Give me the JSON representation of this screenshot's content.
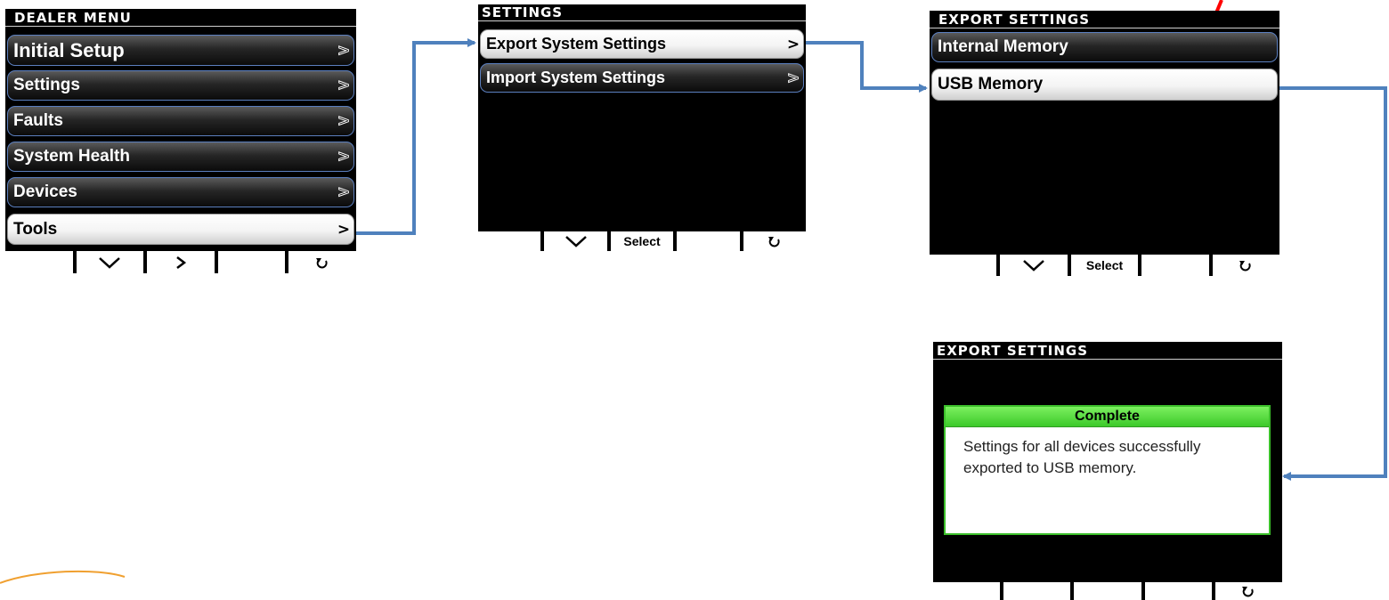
{
  "screens": {
    "dealer_menu": {
      "title": "DEALER MENU",
      "items": [
        {
          "label": "Initial Setup"
        },
        {
          "label": "Settings"
        },
        {
          "label": "Faults"
        },
        {
          "label": "System Health"
        },
        {
          "label": "Devices"
        },
        {
          "label": "Tools"
        }
      ],
      "selected_item": "Tools",
      "softkeys": [
        "",
        "chevron-down",
        "chevron-right",
        "",
        "back"
      ]
    },
    "settings": {
      "title": "SETTINGS",
      "items": [
        {
          "label": "Export System Settings"
        },
        {
          "label": "Import System Settings"
        }
      ],
      "selected_item": "Export System Settings",
      "softkeys": [
        "",
        "chevron-down",
        "Select",
        "",
        "back"
      ],
      "select_label": "Select"
    },
    "export_settings": {
      "title": "EXPORT SETTINGS",
      "items": [
        {
          "label": "Internal Memory"
        },
        {
          "label": "USB Memory"
        }
      ],
      "selected_item": "USB Memory",
      "softkeys": [
        "",
        "chevron-down",
        "Select",
        "",
        "back"
      ],
      "select_label": "Select"
    },
    "export_complete": {
      "title": "EXPORT SETTINGS",
      "dialog_title": "Complete",
      "dialog_message": "Settings for all devices successfully exported to USB memory.",
      "softkeys": [
        "",
        "",
        "",
        "",
        "back"
      ]
    }
  },
  "colors": {
    "screen_bg": "#000000",
    "item_border": "#5b7fbf",
    "flow_arrow": "#4f81bd",
    "highlight_arrow": "#ff0000",
    "dialog_title": "#3cc92a",
    "logo_swoosh": "#f0a030"
  }
}
